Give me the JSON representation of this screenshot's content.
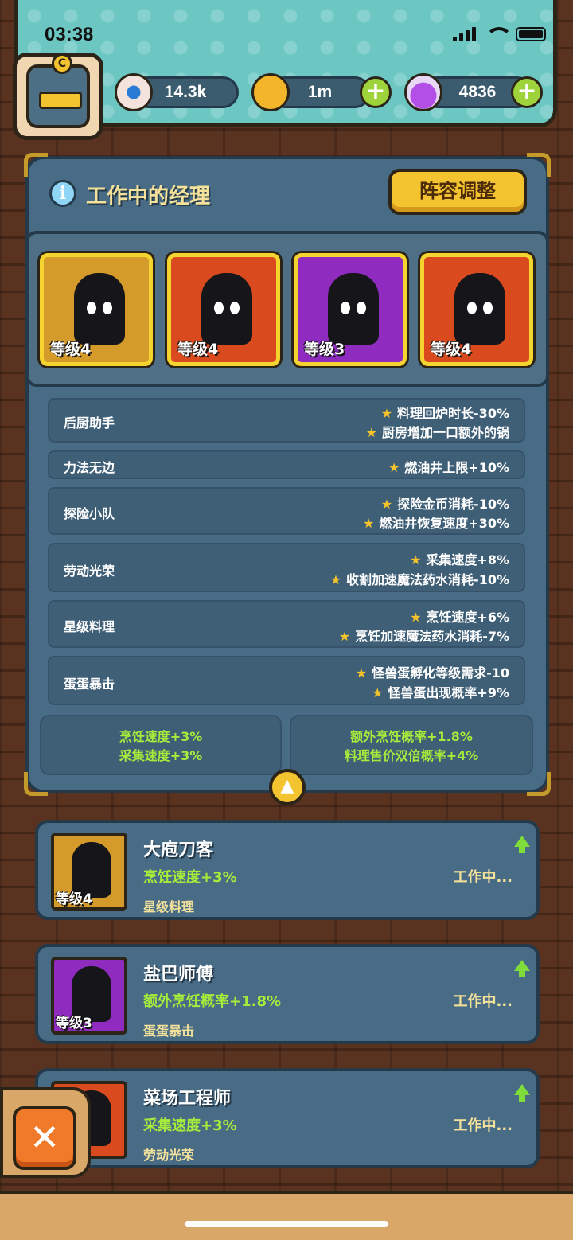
{
  "status": {
    "time": "03:38"
  },
  "resources": {
    "eyes": "14.3k",
    "coins": "1m",
    "potions": "4836"
  },
  "panel": {
    "title": "工作中的经理",
    "lineup_button": "阵容调整"
  },
  "managers": [
    {
      "level": "等级4",
      "color": "#d49a2a"
    },
    {
      "level": "等级4",
      "color": "#d94b1f"
    },
    {
      "level": "等级3",
      "color": "#8f2bbf"
    },
    {
      "level": "等级4",
      "color": "#d94b1f"
    }
  ],
  "skills": [
    {
      "name": "后厨助手",
      "bonuses": [
        "料理回炉时长-30%",
        "厨房增加一口额外的锅"
      ]
    },
    {
      "name": "力法无边",
      "bonuses": [
        "燃油井上限+10%"
      ]
    },
    {
      "name": "探险小队",
      "bonuses": [
        "探险金币消耗-10%",
        "燃油井恢复速度+30%"
      ]
    },
    {
      "name": "劳动光荣",
      "bonuses": [
        "采集速度+8%",
        "收割加速魔法药水消耗-10%"
      ]
    },
    {
      "name": "星级料理",
      "bonuses": [
        "烹饪速度+6%",
        "烹饪加速魔法药水消耗-7%"
      ]
    },
    {
      "name": "蛋蛋暴击",
      "bonuses": [
        "怪兽蛋孵化等级需求-10",
        "怪兽蛋出现概率+9%"
      ]
    }
  ],
  "totals": {
    "left": [
      "烹饪速度+3%",
      "采集速度+3%"
    ],
    "right": [
      "额外烹饪概率+1.8%",
      "料理售价双倍概率+4%"
    ]
  },
  "list": [
    {
      "name": "大庖刀客",
      "bonus": "烹饪速度+3%",
      "skill": "星级料理",
      "level": "等级4",
      "status": "工作中...",
      "color": "#d49a2a"
    },
    {
      "name": "盐巴师傅",
      "bonus": "额外烹饪概率+1.8%",
      "skill": "蛋蛋暴击",
      "level": "等级3",
      "status": "工作中...",
      "color": "#8f2bbf"
    },
    {
      "name": "菜场工程师",
      "bonus": "采集速度+3%",
      "skill": "劳动光荣",
      "level": "",
      "status": "工作中...",
      "color": "#d94b1f"
    }
  ]
}
